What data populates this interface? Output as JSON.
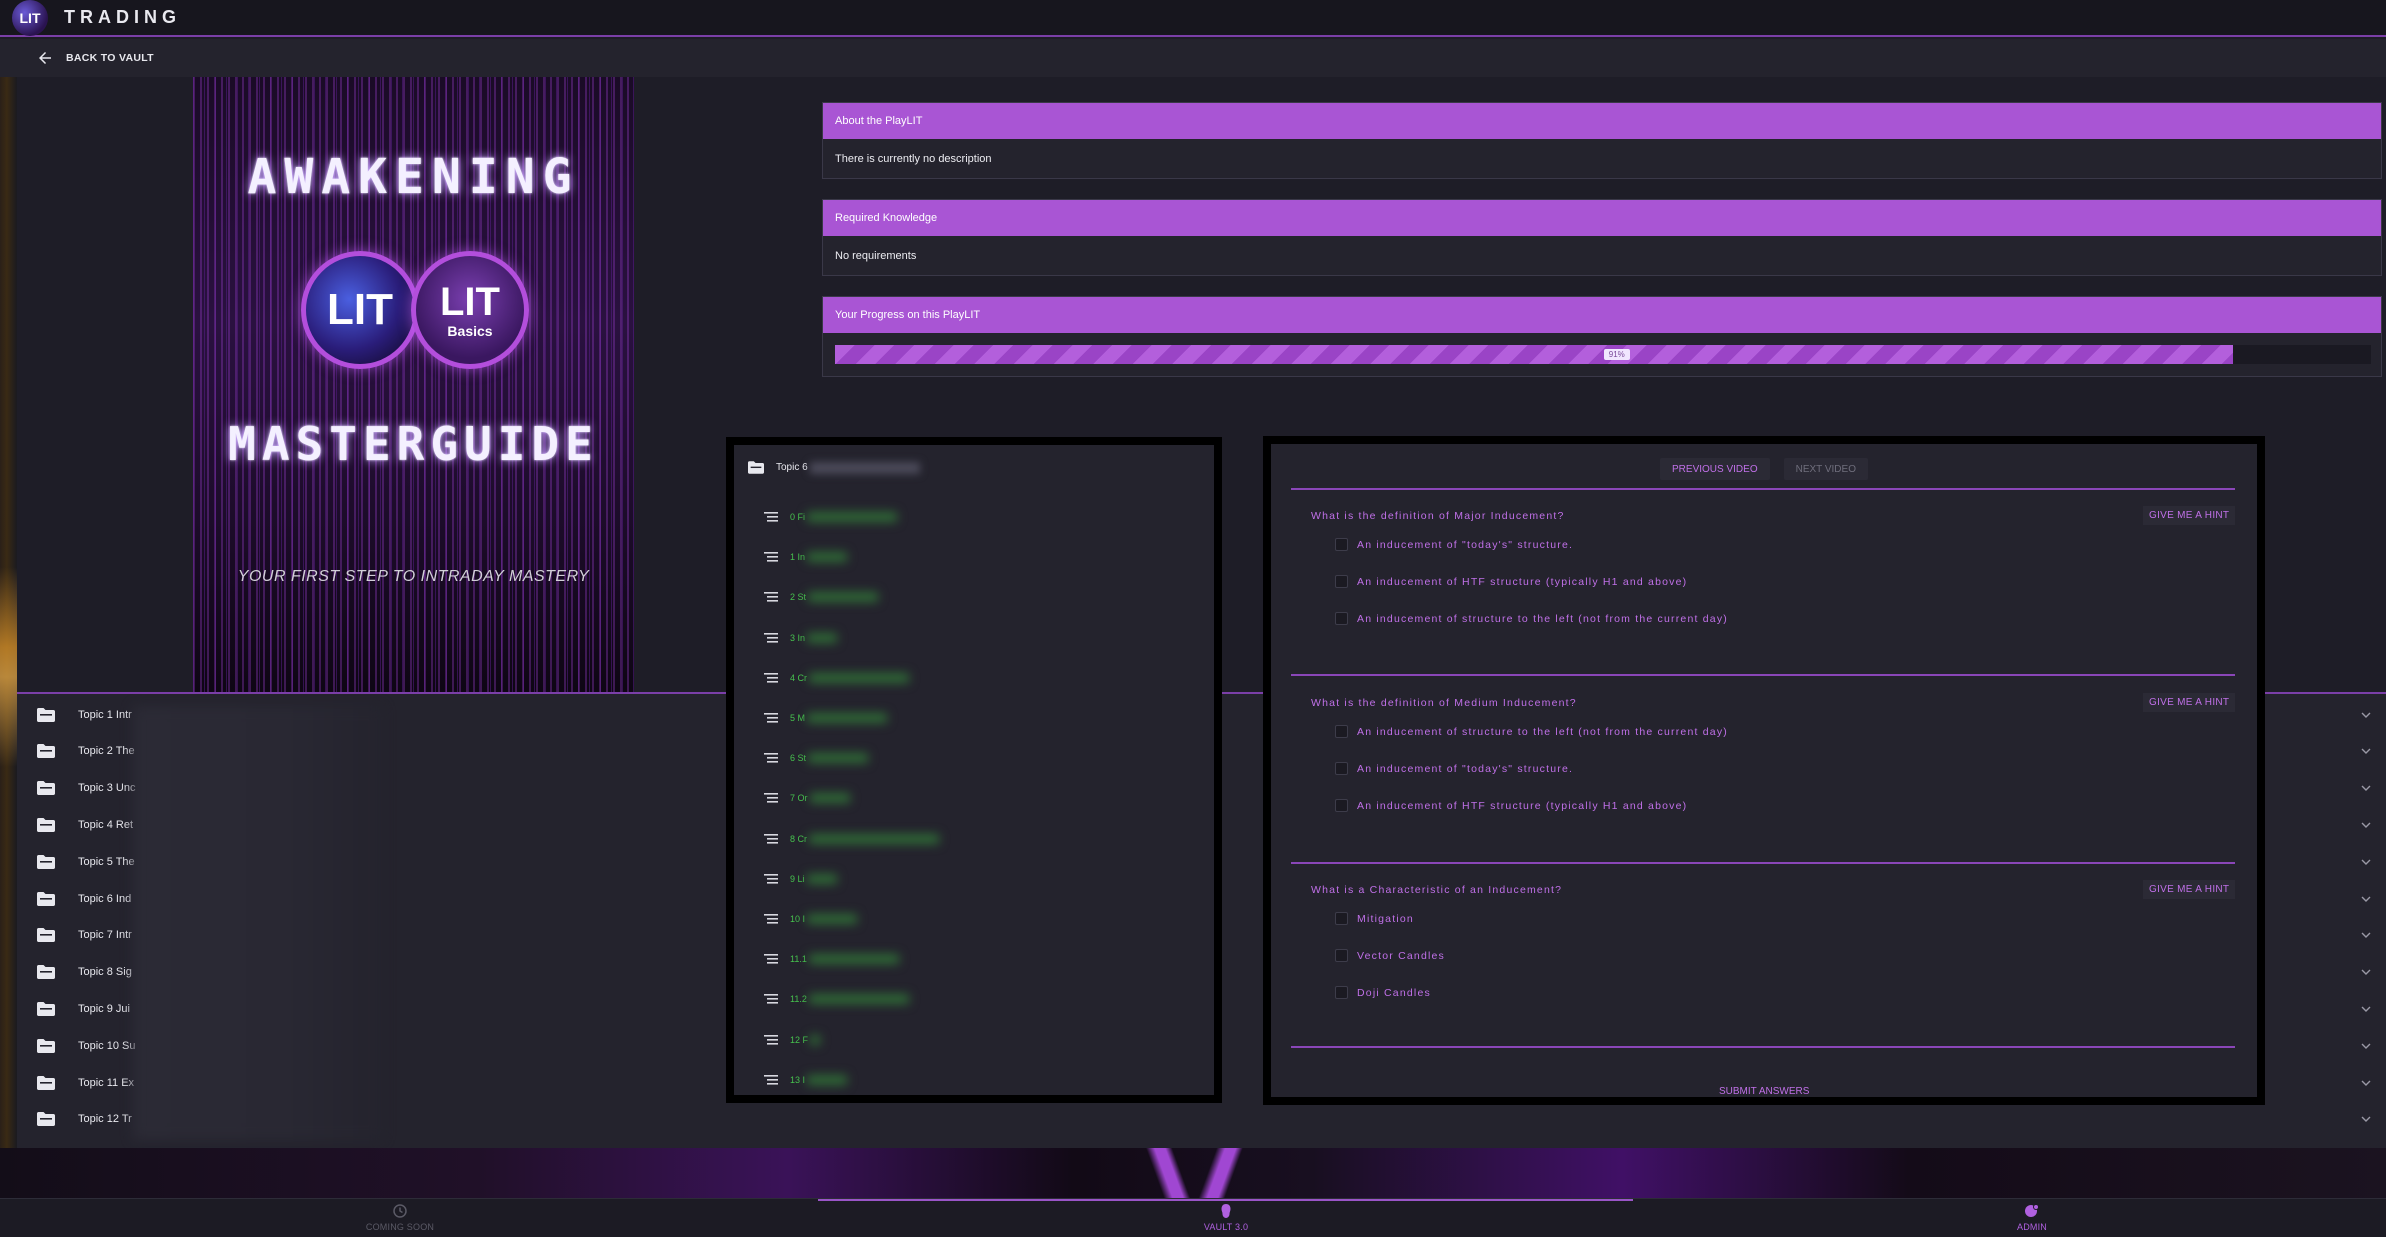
{
  "app": {
    "logo_text": "LIT",
    "title": "TRADING"
  },
  "nav": {
    "back_label": "BACK TO VAULT"
  },
  "cover": {
    "title": "AWAKENING",
    "badge_left": "LIT",
    "badge_right": "LIT",
    "badge_right_sub": "Basics",
    "subtitle": "MASTERGUIDE",
    "tagline": "YOUR FIRST STEP TO INTRADAY MASTERY"
  },
  "about": {
    "heading": "About the PlayLIT",
    "body": "There is currently no description"
  },
  "requirements": {
    "heading": "Required Knowledge",
    "body": "No requirements"
  },
  "progress": {
    "heading": "Your Progress on this PlayLIT",
    "value": 0.91,
    "label": "91%"
  },
  "topics": [
    "Topic 1 Intr",
    "Topic 2 The",
    "Topic 3 Unc",
    "Topic 4 Ret",
    "Topic 5 The",
    "Topic 6 Ind",
    "Topic 7 Intr",
    "Topic 8 Sig",
    "Topic 9 Jui",
    "Topic 10 Su",
    "Topic 11 Ex",
    "Topic 12 Tr"
  ],
  "video_panel": {
    "heading": "Topic 6",
    "items": [
      "0 Fi",
      "1 In",
      "2 St",
      "3 In",
      "4 Cr",
      "5 M",
      "6 St",
      "7 Or",
      "8 Cr",
      "9 Li",
      "10 I",
      "11.1",
      "11.2",
      "12 F",
      "13 I"
    ]
  },
  "quiz": {
    "prev_label": "PREVIOUS VIDEO",
    "next_label": "NEXT VIDEO",
    "hint_label": "GIVE ME A HINT",
    "submit_label": "SUBMIT ANSWERS",
    "questions": [
      {
        "text": "What is the definition of Major Inducement?",
        "options": [
          "An inducement of \"today's\" structure.",
          "An inducement of HTF structure (typically H1 and above)",
          "An inducement of structure to the left (not from the current day)"
        ]
      },
      {
        "text": "What is the definition of Medium Inducement?",
        "options": [
          "An inducement of structure to the left (not from the current day)",
          "An inducement of \"today's\" structure.",
          "An inducement of HTF structure (typically H1 and above)"
        ]
      },
      {
        "text": "What is a Characteristic of an Inducement?",
        "options": [
          "Mitigation",
          "Vector Candles",
          "Doji Candles"
        ]
      }
    ]
  },
  "bottom_nav": [
    {
      "label": "COMING SOON",
      "icon": "clock-icon",
      "color": "#5b5a66"
    },
    {
      "label": "VAULT 3.0",
      "icon": "vault-icon",
      "color": "#b060e0"
    },
    {
      "label": "ADMIN",
      "icon": "admin-icon",
      "color": "#b060e0"
    }
  ],
  "colors": {
    "accent": "#a955d4",
    "link_green": "#46c24e",
    "background": "#1e1d27"
  }
}
